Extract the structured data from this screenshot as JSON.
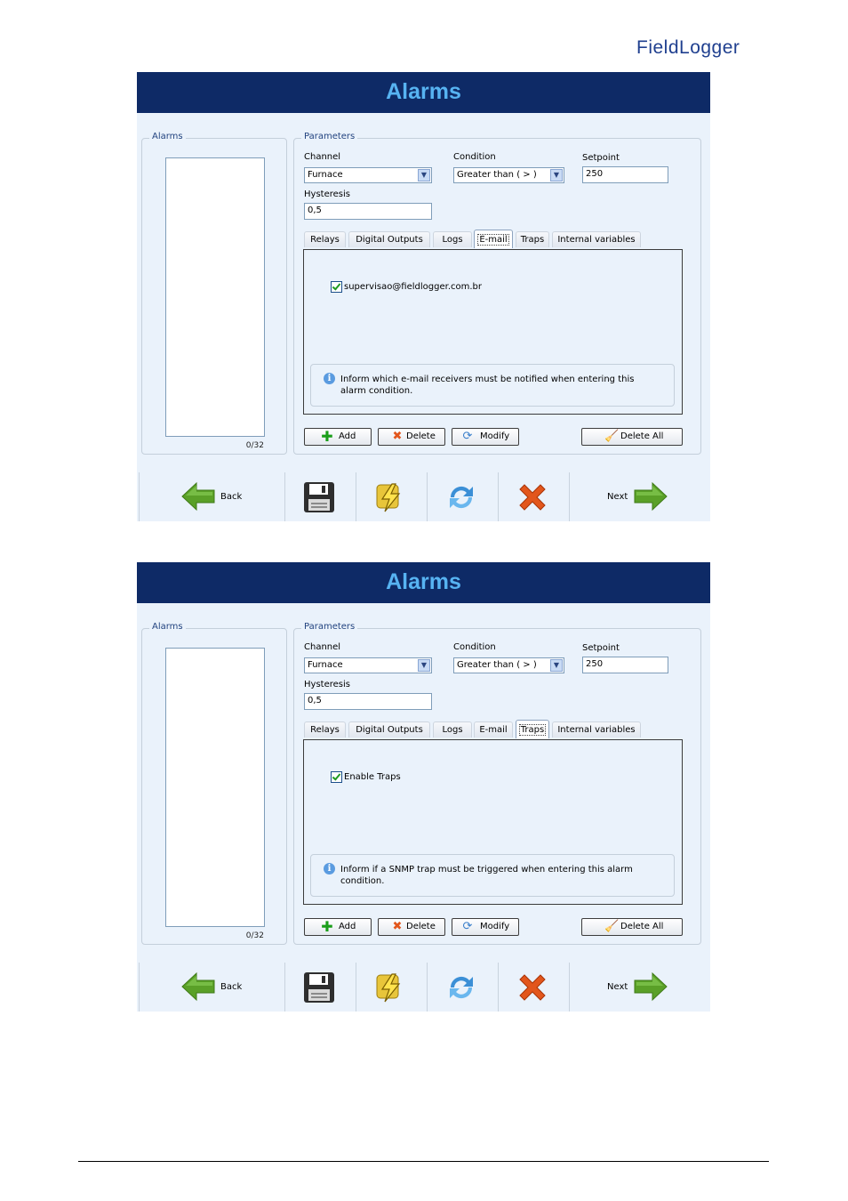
{
  "brand": {
    "logo": "FieldLogger"
  },
  "windows": [
    {
      "title": "Alarms",
      "alarms_group_label": "Alarms",
      "alarm_count": "0/32",
      "parameters_label": "Parameters",
      "channel_label": "Channel",
      "channel_value": "Furnace",
      "condition_label": "Condition",
      "condition_value": "Greater than ( > )",
      "setpoint_label": "Setpoint",
      "setpoint_value": "250",
      "hysteresis_label": "Hysteresis",
      "hysteresis_value": "0,5",
      "tabs": [
        "Relays",
        "Digital Outputs",
        "Logs",
        "E-mail",
        "Traps",
        "Internal variables"
      ],
      "active_tab": "E-mail",
      "check_label": "supervisao@fieldlogger.com.br",
      "info": "Inform which e-mail receivers must be notified when entering this alarm condition.",
      "buttons": {
        "add": "Add",
        "delete": "Delete",
        "modify": "Modify",
        "delete_all": "Delete All"
      },
      "nav": {
        "back": "Back",
        "next": "Next"
      }
    },
    {
      "title": "Alarms",
      "alarms_group_label": "Alarms",
      "alarm_count": "0/32",
      "parameters_label": "Parameters",
      "channel_label": "Channel",
      "channel_value": "Furnace",
      "condition_label": "Condition",
      "condition_value": "Greater than ( > )",
      "setpoint_label": "Setpoint",
      "setpoint_value": "250",
      "hysteresis_label": "Hysteresis",
      "hysteresis_value": "0,5",
      "tabs": [
        "Relays",
        "Digital Outputs",
        "Logs",
        "E-mail",
        "Traps",
        "Internal variables"
      ],
      "active_tab": "Traps",
      "check_label": "Enable Traps",
      "info": "Inform if a SNMP trap must be triggered when entering this alarm condition.",
      "buttons": {
        "add": "Add",
        "delete": "Delete",
        "modify": "Modify",
        "delete_all": "Delete All"
      },
      "nav": {
        "back": "Back",
        "next": "Next"
      }
    }
  ],
  "colors": {
    "header": "#0e2a66",
    "title": "#57b3f2",
    "panel": "#eaf2fb",
    "arrow": "#5aa028",
    "delete": "#e2561c"
  }
}
